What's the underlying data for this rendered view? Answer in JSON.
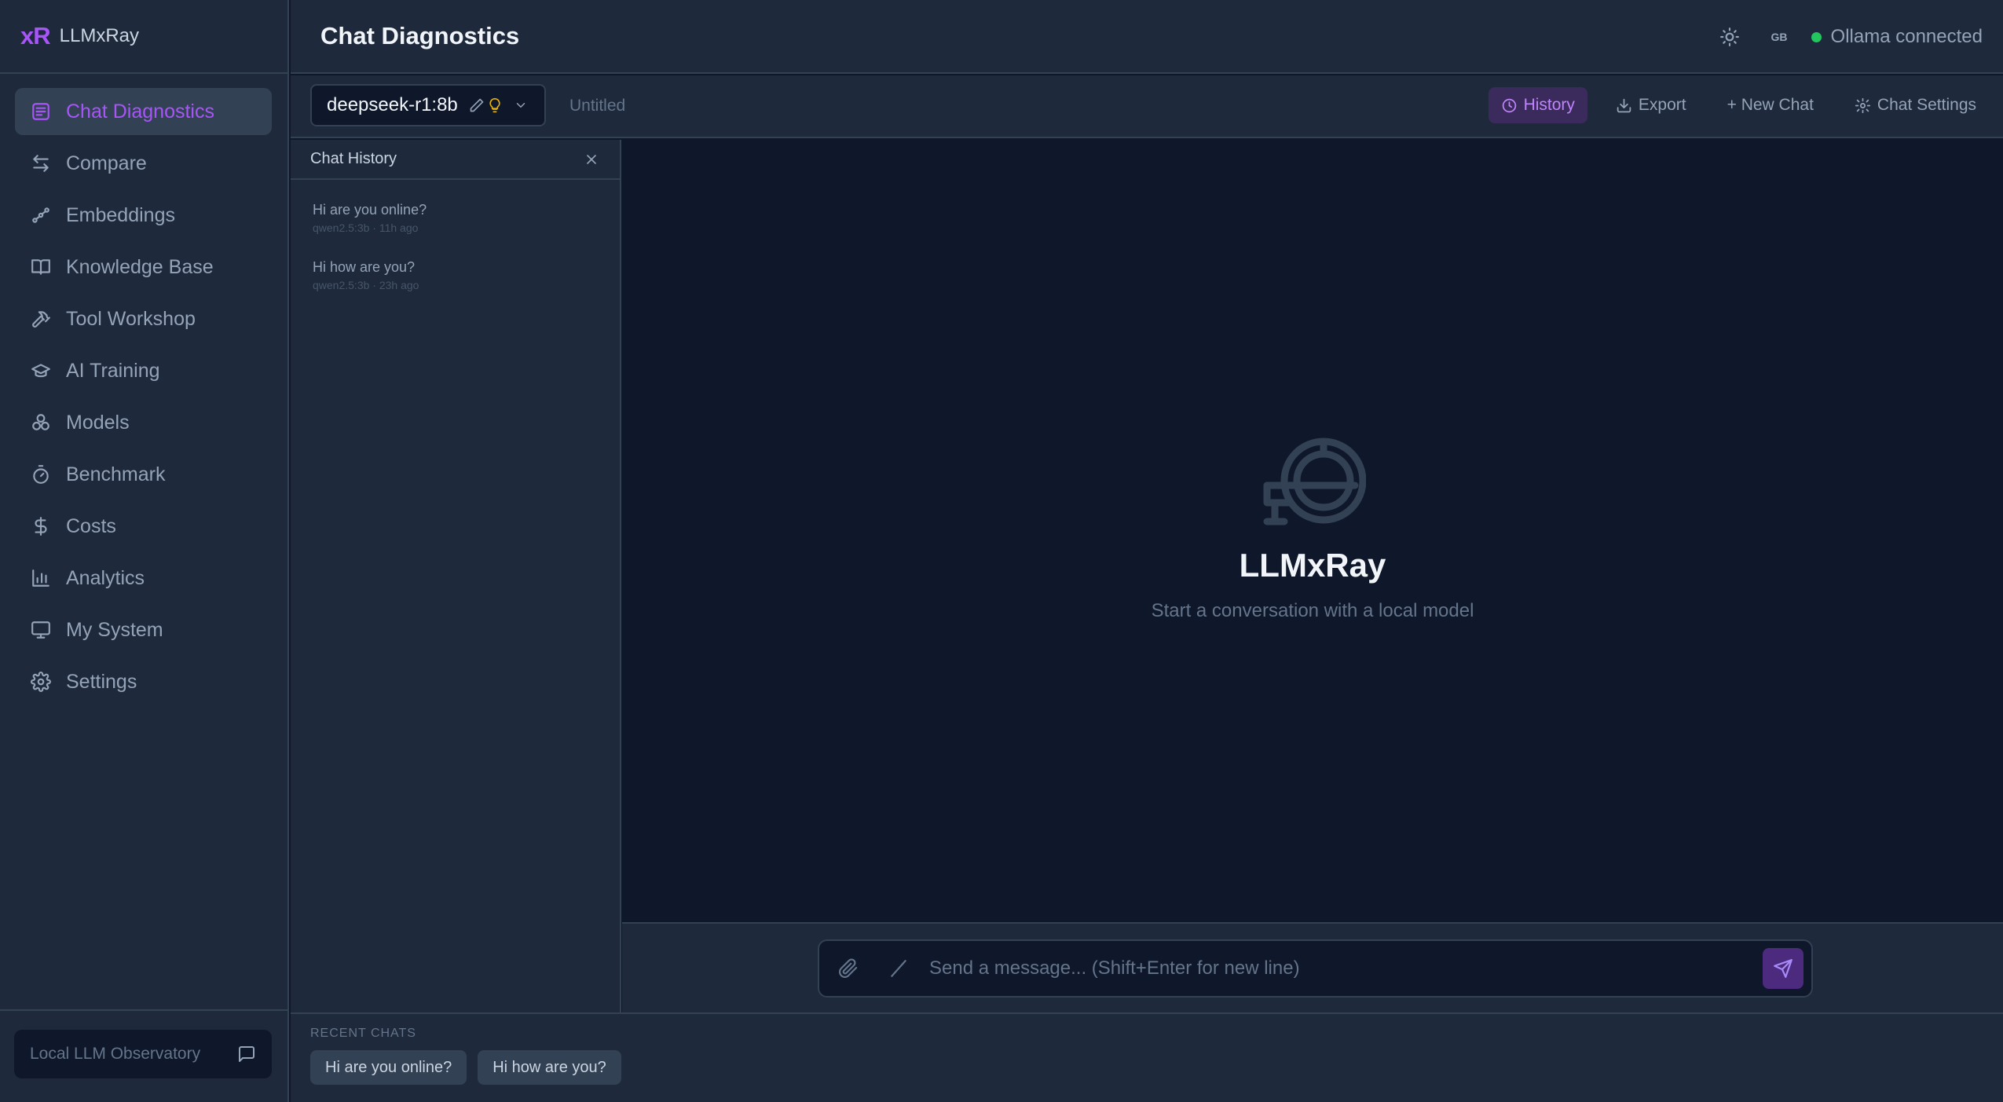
{
  "app": {
    "logo_text": "xR",
    "name": "LLMxRay"
  },
  "sidebar": {
    "items": [
      {
        "label": "Chat Diagnostics",
        "icon": "chat-diagnostics-icon"
      },
      {
        "label": "Compare",
        "icon": "compare-arrows-icon"
      },
      {
        "label": "Embeddings",
        "icon": "embeddings-icon"
      },
      {
        "label": "Knowledge Base",
        "icon": "book-icon"
      },
      {
        "label": "Tool Workshop",
        "icon": "hammer-icon"
      },
      {
        "label": "AI Training",
        "icon": "graduation-cap-icon"
      },
      {
        "label": "Models",
        "icon": "models-icon"
      },
      {
        "label": "Benchmark",
        "icon": "stopwatch-icon"
      },
      {
        "label": "Costs",
        "icon": "dollar-icon"
      },
      {
        "label": "Analytics",
        "icon": "bar-chart-icon"
      },
      {
        "label": "My System",
        "icon": "monitor-icon"
      },
      {
        "label": "Settings",
        "icon": "gear-icon"
      }
    ],
    "active_index": 0,
    "footer_label": "Local LLM Observatory",
    "footer_icon": "message-square-icon"
  },
  "header": {
    "title": "Chat Diagnostics",
    "language": "GB",
    "status_text": "Ollama connected",
    "status_color": "#22c55e"
  },
  "chatbar": {
    "model": "deepseek-r1:8b",
    "chat_title": "Untitled",
    "history_label": "History",
    "export_label": "Export",
    "new_chat_label": "+ New Chat",
    "settings_label": "Chat Settings"
  },
  "history": {
    "title": "Chat History",
    "items": [
      {
        "title": "Hi are you online?",
        "meta": "qwen2.5:3b · 11h ago"
      },
      {
        "title": "Hi how are you?",
        "meta": "qwen2.5:3b · 23h ago"
      }
    ]
  },
  "empty_state": {
    "title": "LLMxRay",
    "subtitle": "Start a conversation with a local model"
  },
  "composer": {
    "placeholder": "Send a message... (Shift+Enter for new line)",
    "value": ""
  },
  "recent": {
    "label": "RECENT CHATS",
    "chips": [
      "Hi are you online?",
      "Hi how are you?"
    ]
  },
  "colors": {
    "accent": "#a855f7",
    "background": "#0f172a",
    "panel": "#1e293b",
    "border": "#334155"
  }
}
